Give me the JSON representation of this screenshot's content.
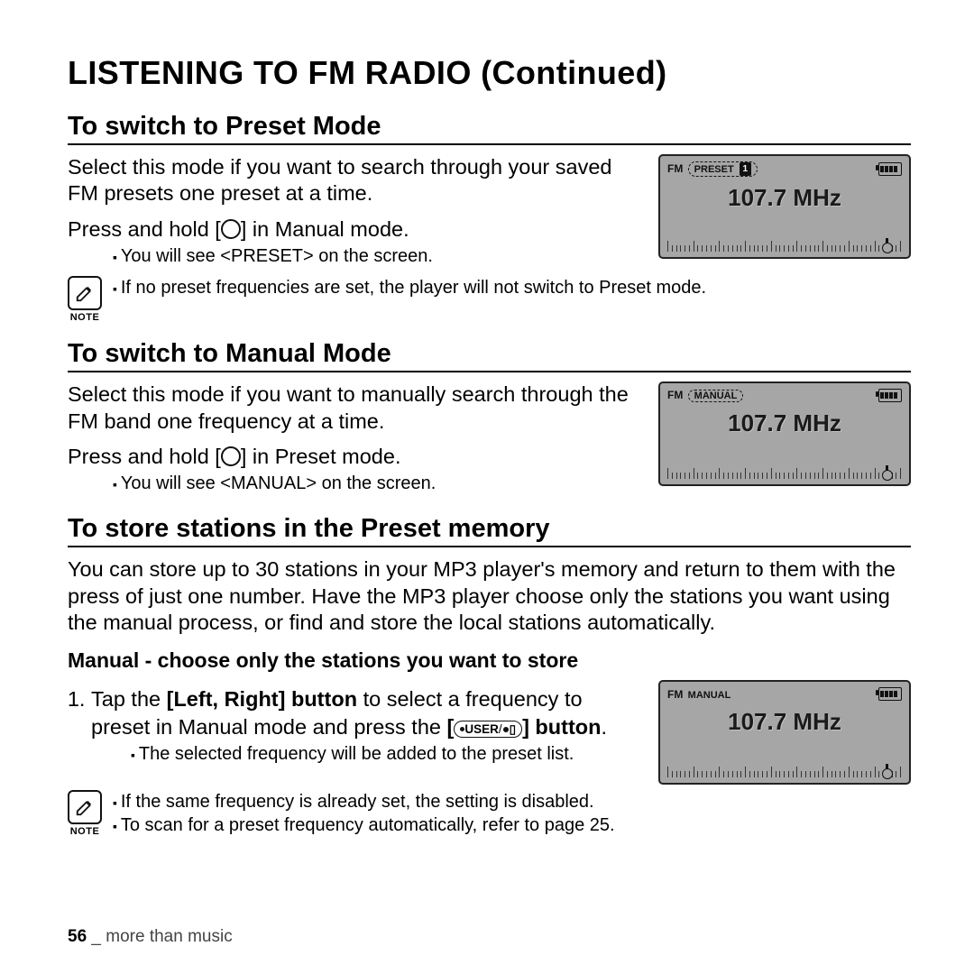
{
  "title": "LISTENING TO FM RADIO (Continued)",
  "section_preset": {
    "heading": "To switch to Preset Mode",
    "p1": "Select this mode if you want to search through your saved FM presets one preset at a time.",
    "p2a": "Press and hold [",
    "p2b": "] in Manual mode.",
    "bullet": "You will see <PRESET> on the screen.",
    "note": "If no preset frequencies are set, the player will not switch to Preset mode.",
    "device": {
      "fm": "FM",
      "mode": "PRESET",
      "num": "1",
      "freq": "107.7 MHz"
    }
  },
  "section_manual": {
    "heading": "To switch to Manual Mode",
    "p1": "Select this mode if you want to manually search through the FM band one frequency at a time.",
    "p2a": "Press and hold [",
    "p2b": "] in Preset mode.",
    "bullet": "You will see <MANUAL> on the screen.",
    "device": {
      "fm": "FM",
      "mode": "MANUAL",
      "freq": "107.7 MHz"
    }
  },
  "section_store": {
    "heading": "To store stations in the Preset memory",
    "p1": "You can store up to 30 stations in your MP3 player's memory and return to them with the press of just one number. Have the MP3 player choose only the stations you want using the manual process, or find and store the local stations automatically.",
    "subhead": "Manual - choose only the stations you want to store",
    "step1_a": "Tap the ",
    "step1_b": "[Left, Right] button",
    "step1_c": " to select a frequency to preset in Manual mode and press the ",
    "step1_d": "[",
    "step1_user": "USER",
    "step1_e": "] button",
    "step1_f": ".",
    "step1_sub": "The selected frequency will be added to the preset list.",
    "note1": "If the same frequency is already set, the setting is disabled.",
    "note2": "To scan for a preset frequency automatically, refer to page 25.",
    "device": {
      "fm": "FM",
      "mode": "MANUAL",
      "freq": "107.7 MHz"
    }
  },
  "note_label": "NOTE",
  "footer": {
    "page": "56",
    "sep": " _ ",
    "text": "more than music"
  }
}
